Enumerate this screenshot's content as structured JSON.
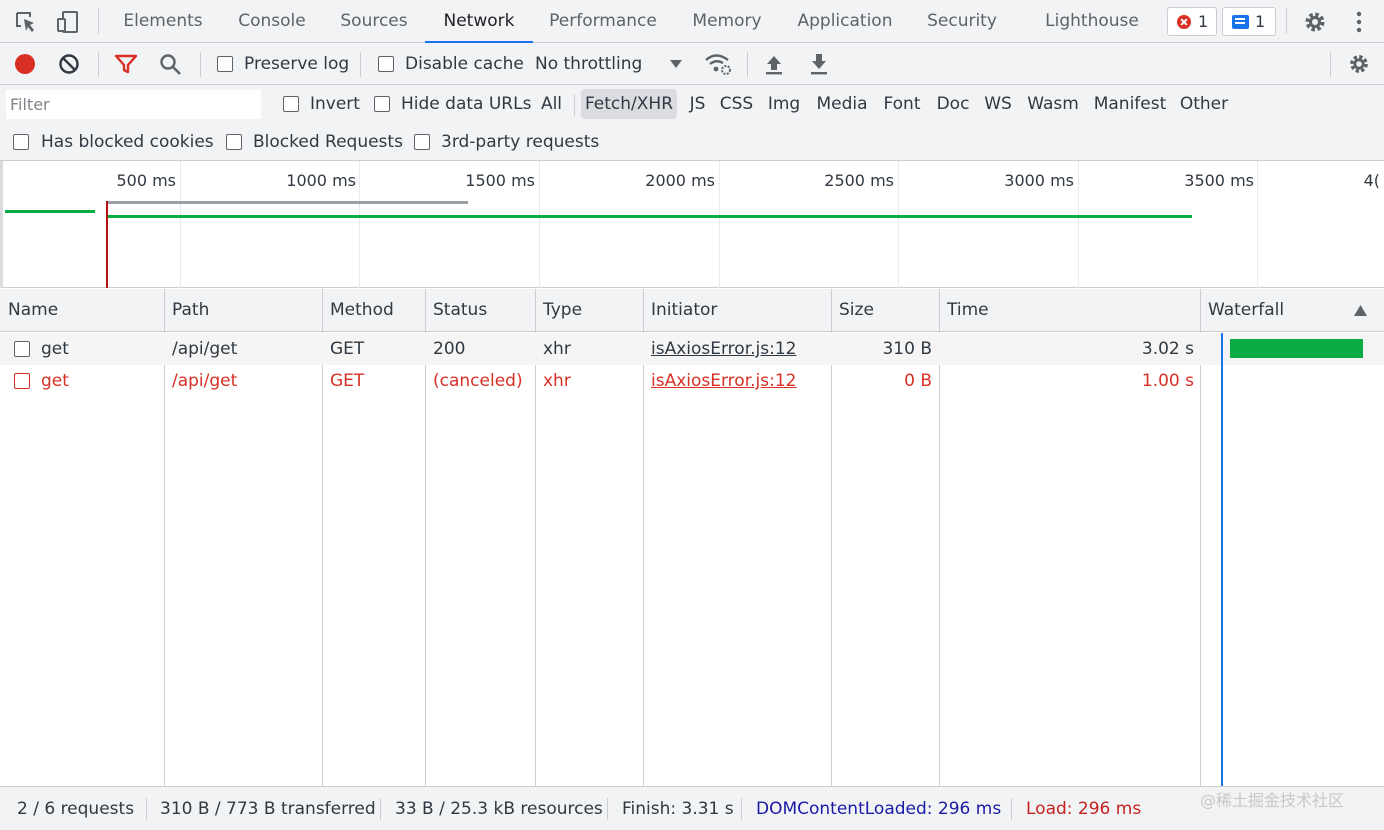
{
  "tabs": [
    "Elements",
    "Console",
    "Sources",
    "Network",
    "Performance",
    "Memory",
    "Application",
    "Security",
    "Lighthouse"
  ],
  "active_tab": "Network",
  "badges": {
    "errors": "1",
    "messages": "1"
  },
  "toolbar": {
    "preserve_log": "Preserve log",
    "disable_cache": "Disable cache",
    "throttling": "No throttling"
  },
  "filter": {
    "placeholder": "Filter",
    "invert": "Invert",
    "hide_data_urls": "Hide data URLs",
    "types": [
      "All",
      "Fetch/XHR",
      "JS",
      "CSS",
      "Img",
      "Media",
      "Font",
      "Doc",
      "WS",
      "Wasm",
      "Manifest",
      "Other"
    ],
    "active_type": "Fetch/XHR",
    "has_blocked_cookies": "Has blocked cookies",
    "blocked_requests": "Blocked Requests",
    "third_party": "3rd-party requests"
  },
  "overview": {
    "ticks": [
      "500 ms",
      "1000 ms",
      "1500 ms",
      "2000 ms",
      "2500 ms",
      "3000 ms",
      "3500 ms",
      "4("
    ]
  },
  "table": {
    "columns": [
      "Name",
      "Path",
      "Method",
      "Status",
      "Type",
      "Initiator",
      "Size",
      "Time",
      "Waterfall"
    ],
    "rows": [
      {
        "name": "get",
        "path": "/api/get",
        "method": "GET",
        "status": "200",
        "type": "xhr",
        "initiator": "isAxiosError.js:12",
        "size": "310 B",
        "time": "3.02 s",
        "error": false
      },
      {
        "name": "get",
        "path": "/api/get",
        "method": "GET",
        "status": "(canceled)",
        "type": "xhr",
        "initiator": "isAxiosError.js:12",
        "size": "0 B",
        "time": "1.00 s",
        "error": true
      }
    ]
  },
  "status": {
    "requests": "2 / 6 requests",
    "transferred": "310 B / 773 B transferred",
    "resources": "33 B / 25.3 kB resources",
    "finish": "Finish: 3.31 s",
    "dcl": "DOMContentLoaded: 296 ms",
    "load": "Load: 296 ms"
  },
  "watermark": "@稀土掘金技术社区",
  "colors": {
    "accent": "#1a73e8",
    "error": "#d93025",
    "bar_green": "#0bab44",
    "dcl": "#1a1aa6",
    "load": "#c5221f"
  }
}
